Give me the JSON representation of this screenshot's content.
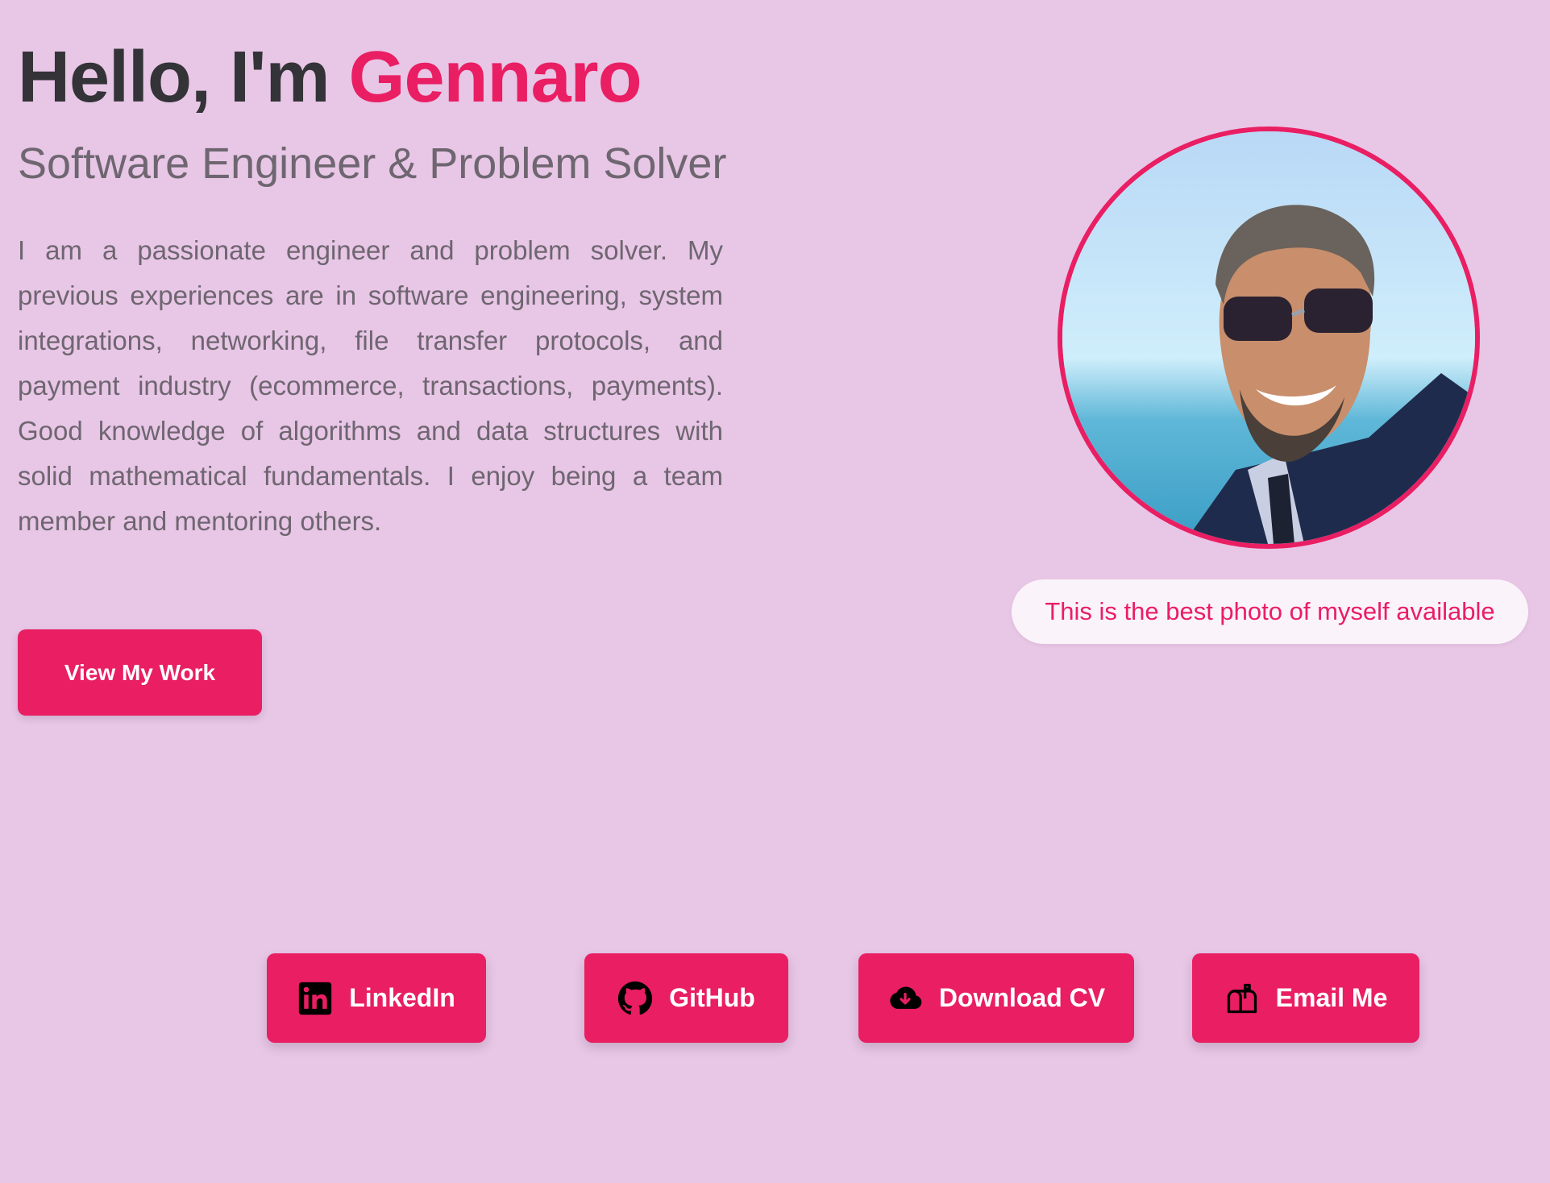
{
  "hero": {
    "greeting": "Hello, I'm ",
    "name": "Gennaro",
    "subtitle": "Software Engineer & Problem Solver",
    "bio": "I am a passionate engineer and problem solver. My previous experiences are in software engineering, system integrations, networking, file transfer protocols, and payment industry (ecommerce, transactions, payments). Good knowledge of algorithms and data structures with solid mathematical fundamentals. I enjoy being a team member and mentoring others.",
    "cta_label": "View My Work"
  },
  "photo": {
    "caption": "This is the best photo of myself available"
  },
  "social": {
    "linkedin_label": "LinkedIn",
    "github_label": "GitHub",
    "cv_label": "Download CV",
    "email_label": "Email Me"
  },
  "colors": {
    "background": "#e8c6e6",
    "accent": "#e91e63",
    "heading": "#333338",
    "body_text": "#6e6670"
  },
  "icons": [
    "linkedin-icon",
    "github-icon",
    "cloud-download-icon",
    "mailbox-icon"
  ]
}
